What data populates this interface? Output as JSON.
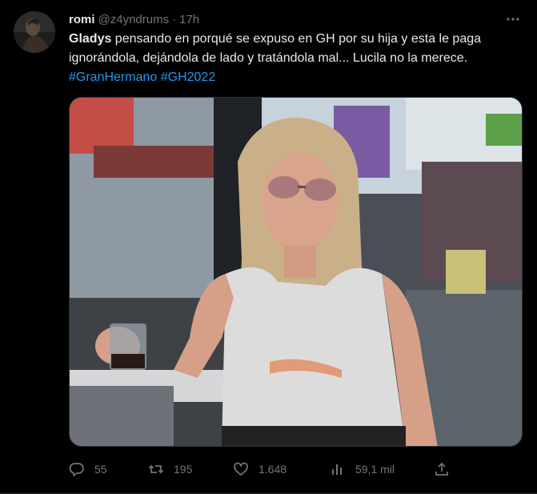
{
  "tweet": {
    "display_name": "romi",
    "handle": "@z4yndrums",
    "separator": "·",
    "time": "17h",
    "text_bold": "Gladys",
    "text_body": " pensando en porqué se expuso en GH por su hija y esta le paga ignorándola, dejándola de lado y tratándola mal... Lucila no la merece.",
    "hashtags": [
      "#GranHermano",
      "#GH2022"
    ],
    "media_alt_icon": "photo"
  },
  "actions": {
    "reply_count": "55",
    "retweet_count": "195",
    "like_count": "1.648",
    "views_count": "59,1 mil"
  },
  "icons": {
    "more": "more-dots-icon",
    "reply": "reply-icon",
    "retweet": "retweet-icon",
    "like": "heart-icon",
    "views": "views-chart-icon",
    "share": "share-icon"
  },
  "colors": {
    "background": "#000000",
    "text": "#e7e9ea",
    "muted": "#71767b",
    "link": "#1d9bf0"
  }
}
